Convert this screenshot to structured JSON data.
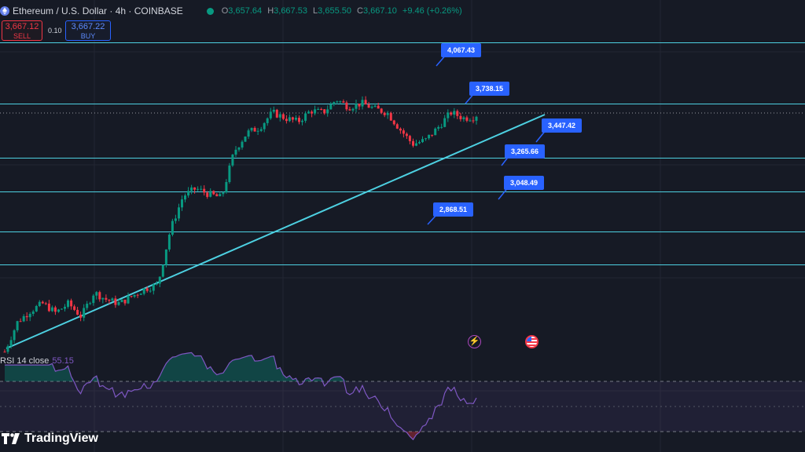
{
  "symbol": {
    "title": "Ethereum / U.S. Dollar · 4h · COINBASE",
    "ohlc": [
      {
        "k": "O",
        "v": "3,657.64"
      },
      {
        "k": "H",
        "v": "3,667.53"
      },
      {
        "k": "L",
        "v": "3,655.50"
      },
      {
        "k": "C",
        "v": "3,667.10"
      }
    ],
    "change": "+9.46 (+0.26%)"
  },
  "trade": {
    "sell_price": "3,667.12",
    "sell_label": "SELL",
    "spread": "0.10",
    "buy_price": "3,667.22",
    "buy_label": "BUY"
  },
  "levels": [
    {
      "label": "4,067.43"
    },
    {
      "label": "3,738.15"
    },
    {
      "label": "3,447.42"
    },
    {
      "label": "3,265.66"
    },
    {
      "label": "3,048.49"
    },
    {
      "label": "2,868.51"
    }
  ],
  "rsi": {
    "title": "RSI 14 close",
    "value": "55.15"
  },
  "branding": {
    "name": "TradingView"
  },
  "events": [
    "lightning-icon",
    "us-flag-icon"
  ],
  "colors": {
    "up": "#089981",
    "down": "#f23645",
    "level": "#4dd0e1",
    "tag": "#2962ff",
    "rsi": "#7e57c2"
  },
  "chart_data": {
    "type": "candlestick",
    "price_axis_hidden": true,
    "horizontal_levels": [
      4067.43,
      3738.15,
      3447.42,
      3265.66,
      3048.49,
      2868.51
    ],
    "trendline": "ascending support from the lows",
    "close_path": [
      2400,
      2560,
      2620,
      2660,
      2610,
      2660,
      2590,
      2720,
      2680,
      2660,
      2700,
      2740,
      2760,
      3060,
      3240,
      3280,
      3250,
      3230,
      3480,
      3580,
      3610,
      3690,
      3660,
      3640,
      3700,
      3690,
      3760,
      3720,
      3740,
      3710,
      3690,
      3600,
      3520,
      3540,
      3610,
      3690,
      3660,
      3667.1
    ],
    "rsi": {
      "length": 14,
      "source": "close",
      "last": 55.15,
      "bands": [
        70,
        50,
        30
      ]
    }
  }
}
